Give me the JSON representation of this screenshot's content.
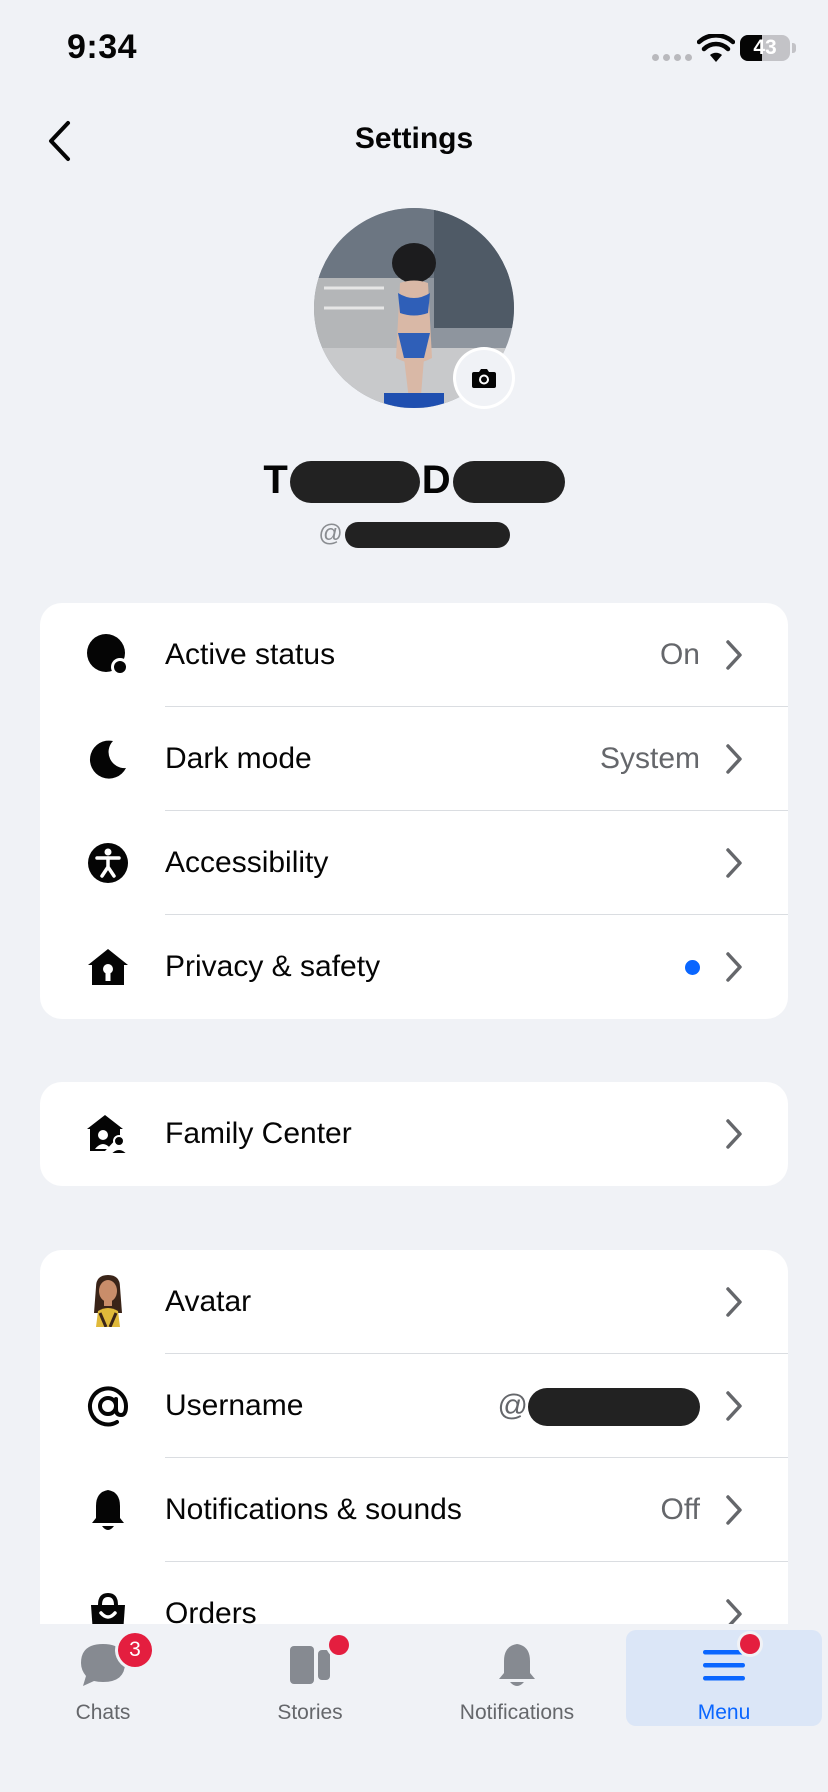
{
  "status_bar": {
    "time": "9:34",
    "battery": "43"
  },
  "header": {
    "title": "Settings"
  },
  "profile": {
    "name_first": "T",
    "name_mid": "D",
    "handle_prefix": "@"
  },
  "sections": [
    [
      {
        "icon": "active-status-icon",
        "label": "Active status",
        "value": "On"
      },
      {
        "icon": "moon-icon",
        "label": "Dark mode",
        "value": "System"
      },
      {
        "icon": "accessibility-icon",
        "label": "Accessibility",
        "value": ""
      },
      {
        "icon": "privacy-house-lock-icon",
        "label": "Privacy & safety",
        "value": ""
      }
    ],
    [
      {
        "icon": "family-center-icon",
        "label": "Family Center",
        "value": ""
      }
    ],
    [
      {
        "icon": "avatar-icon",
        "label": "Avatar",
        "value": ""
      },
      {
        "icon": "at-sign-icon",
        "label": "Username",
        "value": "@"
      },
      {
        "icon": "bell-icon",
        "label": "Notifications & sounds",
        "value": "Off"
      },
      {
        "icon": "shopping-bag-icon",
        "label": "Orders",
        "value": ""
      }
    ]
  ],
  "tabbar": {
    "tabs": [
      {
        "label": "Chats",
        "badge": "3"
      },
      {
        "label": "Stories",
        "badge": ""
      },
      {
        "label": "Notifications",
        "badge": ""
      },
      {
        "label": "Menu",
        "badge": ""
      }
    ]
  },
  "colors": {
    "accent": "#0a66ff",
    "badge": "#e41e3f",
    "background": "#f0f2f6"
  }
}
